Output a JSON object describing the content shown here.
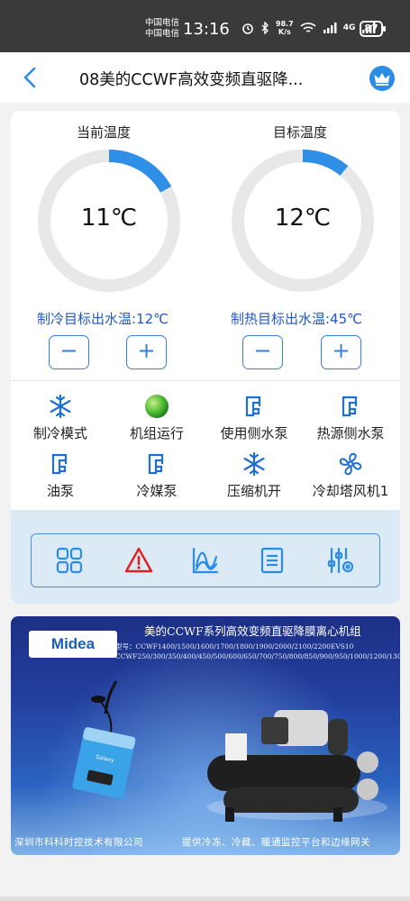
{
  "status_bar": {
    "carrier_1": "中国电信",
    "carrier_2": "中国电信",
    "time": "13:16",
    "net_speed_value": "98.7",
    "net_speed_unit": "K/s",
    "network": "4G",
    "battery": "87"
  },
  "nav": {
    "title": "08美的CCWF高效变频直驱降...",
    "accent_color": "#2b8ce6"
  },
  "gauges": [
    {
      "label": "当前温度",
      "value": "11℃",
      "fill_fraction": 0.17
    },
    {
      "label": "目标温度",
      "value": "12℃",
      "fill_fraction": 0.11
    }
  ],
  "setpoints": {
    "cooling_text": "制冷目标出水温:12℃",
    "heating_text": "制热目标出水温:45℃",
    "minus_symbol": "−",
    "plus_symbol": "+"
  },
  "status_items": [
    {
      "label": "制冷模式",
      "icon": "snowflake-icon"
    },
    {
      "label": "机组运行",
      "icon": "green-indicator-icon"
    },
    {
      "label": "使用侧水泵",
      "icon": "pump-icon"
    },
    {
      "label": "热源侧水泵",
      "icon": "pump-icon"
    },
    {
      "label": "油泵",
      "icon": "pump-icon"
    },
    {
      "label": "冷媒泵",
      "icon": "pump-icon"
    },
    {
      "label": "压缩机开",
      "icon": "snowflake-icon"
    },
    {
      "label": "冷却塔风机1",
      "icon": "fan-icon"
    }
  ],
  "toolbar": [
    {
      "icon": "grid-icon"
    },
    {
      "icon": "alarm-warning-icon"
    },
    {
      "icon": "trend-chart-icon"
    },
    {
      "icon": "list-document-icon"
    },
    {
      "icon": "settings-sliders-icon"
    }
  ],
  "banner": {
    "logo": "Midea",
    "title": "美的CCWF系列高效变频直驱降膜离心机组",
    "model_line_1": "型号：CCWF1400/1500/1600/1700/1800/1900/2000/2100/2200EVS10",
    "model_line_2": "CCWF250/300/350/400/450/500/600/650/700/750/800/850/900/950/1000/1200/1300EV",
    "company": "深圳市科科时控技术有限公司",
    "slogan": "提供冷冻、冷藏、暖通监控平台和边缘网关",
    "device_label": "Galaxy"
  },
  "colors": {
    "gauge_track": "#e8e8e8",
    "gauge_fill": "#2f8ee5",
    "setpoint_text": "#1f59c0",
    "icon_blue": "#1f6fd1",
    "warning_red": "#e02020",
    "running_green": "#33aa33"
  }
}
